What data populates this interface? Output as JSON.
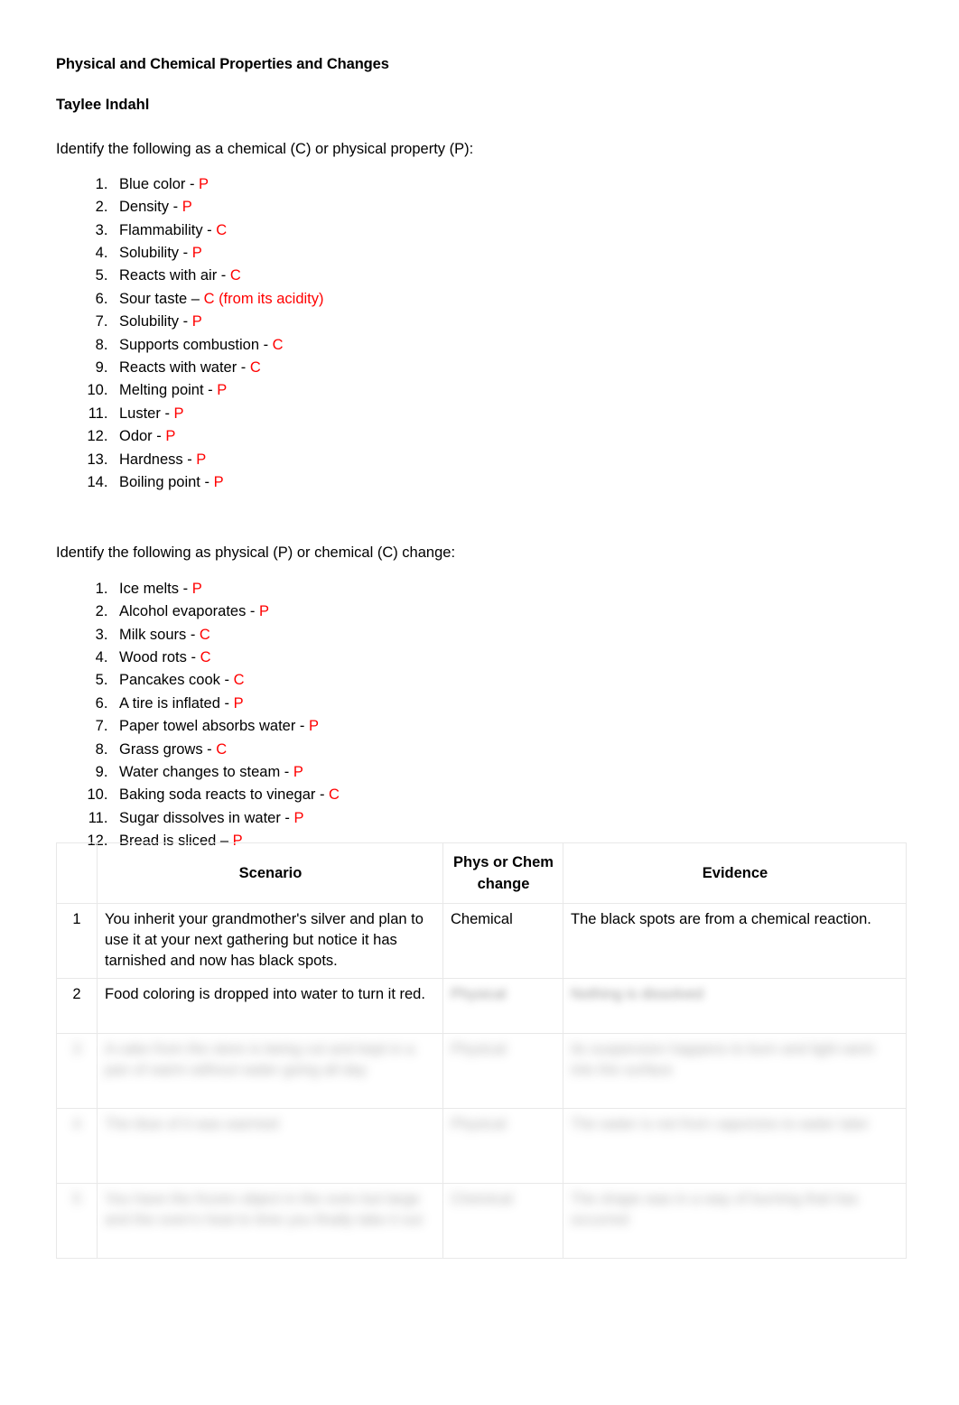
{
  "document": {
    "title": "Physical and Chemical Properties and Changes",
    "author": "Taylee Indahl"
  },
  "section1": {
    "prompt": "Identify the following as a chemical (C) or physical property (P):",
    "items": [
      {
        "n": 1,
        "text": "Blue color - ",
        "answer": "P"
      },
      {
        "n": 2,
        "text": "Density - ",
        "answer": "P"
      },
      {
        "n": 3,
        "text": "Flammability - ",
        "answer": "C"
      },
      {
        "n": 4,
        "text": "Solubility - ",
        "answer": "P"
      },
      {
        "n": 5,
        "text": "Reacts with air - ",
        "answer": "C"
      },
      {
        "n": 6,
        "text": "Sour taste – ",
        "answer": "C (from its acidity)"
      },
      {
        "n": 7,
        "text": "Solubility - ",
        "answer": "P"
      },
      {
        "n": 8,
        "text": "Supports combustion - ",
        "answer": "C"
      },
      {
        "n": 9,
        "text": "Reacts with water - ",
        "answer": "C"
      },
      {
        "n": 10,
        "text": "Melting point - ",
        "answer": "P"
      },
      {
        "n": 11,
        "text": "Luster - ",
        "answer": "P"
      },
      {
        "n": 12,
        "text": "Odor - ",
        "answer": "P"
      },
      {
        "n": 13,
        "text": "Hardness - ",
        "answer": "P"
      },
      {
        "n": 14,
        "text": "Boiling point - ",
        "answer": "P"
      }
    ]
  },
  "section2": {
    "prompt": "Identify the following as physical (P) or chemical (C) change:",
    "items": [
      {
        "n": 1,
        "text": "Ice melts - ",
        "answer": "P"
      },
      {
        "n": 2,
        "text": "Alcohol evaporates - ",
        "answer": "P"
      },
      {
        "n": 3,
        "text": "Milk sours - ",
        "answer": "C"
      },
      {
        "n": 4,
        "text": "Wood rots - ",
        "answer": "C"
      },
      {
        "n": 5,
        "text": "Pancakes cook - ",
        "answer": "C"
      },
      {
        "n": 6,
        "text": "A tire is inflated - ",
        "answer": "P"
      },
      {
        "n": 7,
        "text": "Paper towel absorbs water - ",
        "answer": "P"
      },
      {
        "n": 8,
        "text": "Grass grows - ",
        "answer": "C"
      },
      {
        "n": 9,
        "text": "Water changes to steam - ",
        "answer": "P"
      },
      {
        "n": 10,
        "text": "Baking soda reacts to vinegar - ",
        "answer": "C"
      },
      {
        "n": 11,
        "text": "Sugar dissolves in water - ",
        "answer": "P"
      },
      {
        "n": 12,
        "text": "Bread is sliced – ",
        "answer": "P"
      }
    ]
  },
  "table": {
    "headers": {
      "num": "",
      "scenario": "Scenario",
      "change": "Phys or Chem change",
      "evidence": "Evidence"
    },
    "rows": [
      {
        "num": "1",
        "scenario": "You inherit your grandmother's silver and plan to use it at your next gathering but notice it has tarnished and now has black spots.",
        "change": "Chemical",
        "evidence": "The black spots are from a chemical reaction.",
        "blurred": false
      },
      {
        "num": "2",
        "scenario": "Food coloring is dropped into water to turn it red.",
        "change": "Physical",
        "evidence": "Nothing is dissolved",
        "blurred": "partial"
      },
      {
        "num": "3",
        "scenario": "A cake from the store is being cut and kept in a pan of warm without water going all day",
        "change": "Physical",
        "evidence": "Its suspension happens to burn and light went into the surface",
        "blurred": true
      },
      {
        "num": "4",
        "scenario": "The blue of it was warmed",
        "change": "Physical",
        "evidence": "The water is not from vaporizes to water later",
        "blurred": true
      },
      {
        "num": "5",
        "scenario": "You have the frozen object in the oven but large and the oven's heat to time you finally take it out",
        "change": "Chemical",
        "evidence": "The shape was in a way of burning that has occurred",
        "blurred": true
      }
    ]
  }
}
